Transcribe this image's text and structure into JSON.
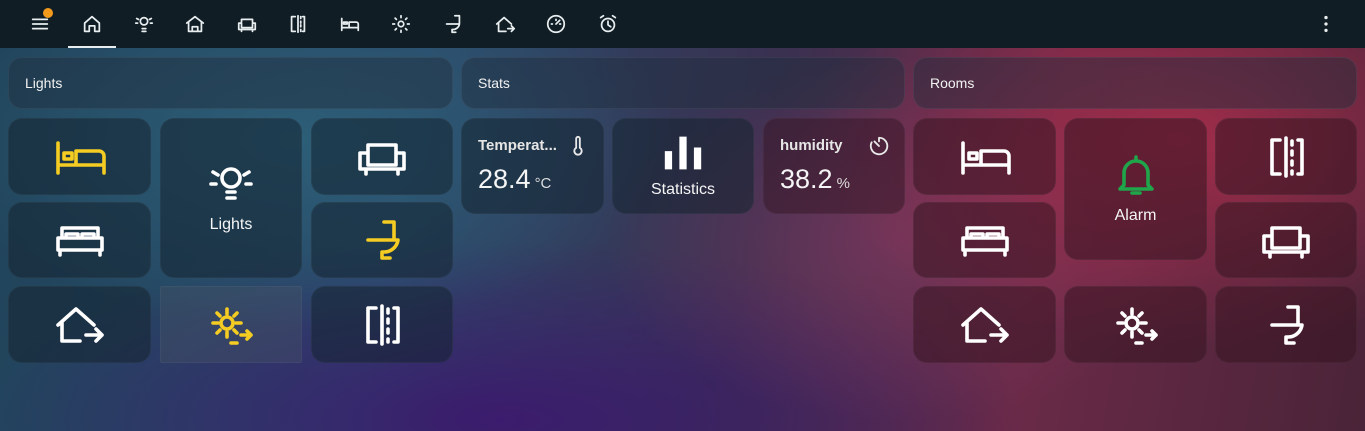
{
  "toolbar": {
    "icons": [
      "menu-icon",
      "home-icon",
      "lightbulb-group-icon",
      "house-icon",
      "sofa-icon",
      "door-open-icon",
      "bed-icon",
      "gear-icon",
      "toilet-icon",
      "home-export-icon",
      "gauge-icon",
      "alarm-clock-icon",
      "dots-vertical-icon"
    ],
    "notification_color": "#f39a1b"
  },
  "sections": {
    "lights": {
      "title": "Lights"
    },
    "stats": {
      "title": "Stats"
    },
    "rooms": {
      "title": "Rooms"
    }
  },
  "lights_tiles": {
    "main_label": "Lights"
  },
  "stats": {
    "temperature": {
      "name": "Temperat...",
      "value": "28.4",
      "unit": "°C"
    },
    "statistics": {
      "label": "Statistics"
    },
    "humidity": {
      "name": "humidity",
      "value": "38.2",
      "unit": "%"
    }
  },
  "rooms_tiles": {
    "alarm_label": "Alarm"
  },
  "colors": {
    "active_icon": "#f5cc22",
    "alarm_icon": "#1fa64a",
    "topbar": "#101d24"
  }
}
